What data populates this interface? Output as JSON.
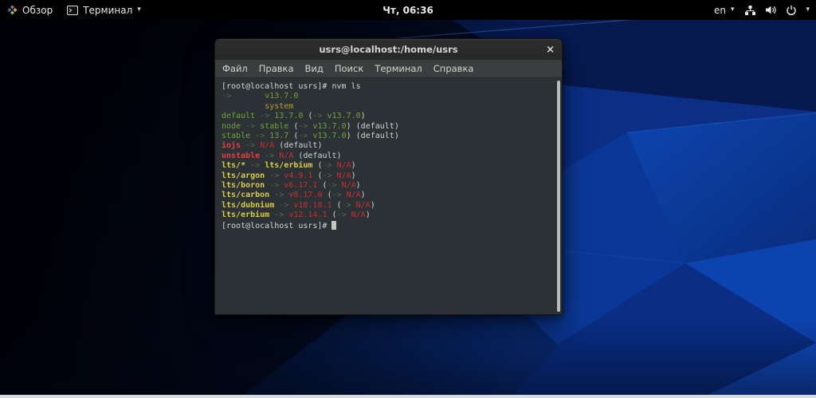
{
  "palette": {
    "topbar_bg": "#000000",
    "titlebar_bg": "#2e2e2e",
    "menubar_bg": "#3a3e3f",
    "term_bg": "#2b3134",
    "term_fg": "#d3d7cf",
    "green": "#6fa436",
    "dim_arrow": "#5b6a48",
    "yellow": "#b1a02a",
    "yellow_bright": "#d8cb46",
    "red": "#ce2d2d",
    "red_bright": "#eb3d3d",
    "cursor": "#c2c8bd",
    "scrollbar": "#b6bbb9",
    "strip": "#d7dadd",
    "wall_bright": "#0c3da4"
  },
  "top_bar": {
    "activities_label": "Обзор",
    "app_menu_label": "Терминал",
    "clock": "Чт, 06:36",
    "language_label": "en",
    "caret": "▾"
  },
  "window": {
    "title": "usrs@localhost:/home/usrs",
    "close_glyph": "×",
    "menu_items": [
      "Файл",
      "Правка",
      "Вид",
      "Поиск",
      "Терминал",
      "Справка"
    ],
    "terminal": {
      "cursor_visible": true,
      "lines": [
        [
          {
            "t": "[root@localhost usrs]# nvm ls",
            "c": "fg"
          }
        ],
        [
          {
            "t": "->",
            "c": "dim"
          },
          {
            "t": "       ",
            "c": "fg"
          },
          {
            "t": "v13.7.0",
            "c": "green"
          }
        ],
        [
          {
            "t": "         system",
            "c": "yellow"
          }
        ],
        [
          {
            "t": "default",
            "c": "green"
          },
          {
            "t": " ",
            "c": "fg"
          },
          {
            "t": "->",
            "c": "dim"
          },
          {
            "t": " ",
            "c": "fg"
          },
          {
            "t": "13.7.0",
            "c": "green"
          },
          {
            "t": " (",
            "c": "fg"
          },
          {
            "t": "->",
            "c": "dim"
          },
          {
            "t": " ",
            "c": "fg"
          },
          {
            "t": "v13.7.0",
            "c": "green"
          },
          {
            "t": ")",
            "c": "fg"
          }
        ],
        [
          {
            "t": "node",
            "c": "green"
          },
          {
            "t": " ",
            "c": "fg"
          },
          {
            "t": "->",
            "c": "dim"
          },
          {
            "t": " ",
            "c": "fg"
          },
          {
            "t": "stable",
            "c": "green"
          },
          {
            "t": " (",
            "c": "fg"
          },
          {
            "t": "->",
            "c": "dim"
          },
          {
            "t": " ",
            "c": "fg"
          },
          {
            "t": "v13.7.0",
            "c": "green"
          },
          {
            "t": ") (default)",
            "c": "fg"
          }
        ],
        [
          {
            "t": "stable",
            "c": "green"
          },
          {
            "t": " ",
            "c": "fg"
          },
          {
            "t": "->",
            "c": "dim"
          },
          {
            "t": " ",
            "c": "fg"
          },
          {
            "t": "13.7",
            "c": "green"
          },
          {
            "t": " (",
            "c": "fg"
          },
          {
            "t": "->",
            "c": "dim"
          },
          {
            "t": " ",
            "c": "fg"
          },
          {
            "t": "v13.7.0",
            "c": "green"
          },
          {
            "t": ") (default)",
            "c": "fg"
          }
        ],
        [
          {
            "t": "iojs",
            "c": "bred",
            "b": 1
          },
          {
            "t": " ",
            "c": "fg"
          },
          {
            "t": "->",
            "c": "dim"
          },
          {
            "t": " ",
            "c": "fg"
          },
          {
            "t": "N/A",
            "c": "red"
          },
          {
            "t": " (default)",
            "c": "fg"
          }
        ],
        [
          {
            "t": "unstable",
            "c": "bred",
            "b": 1
          },
          {
            "t": " ",
            "c": "fg"
          },
          {
            "t": "->",
            "c": "dim"
          },
          {
            "t": " ",
            "c": "fg"
          },
          {
            "t": "N/A",
            "c": "red"
          },
          {
            "t": " (default)",
            "c": "fg"
          }
        ],
        [
          {
            "t": "lts/*",
            "c": "byellow",
            "b": 1
          },
          {
            "t": " ",
            "c": "fg"
          },
          {
            "t": "->",
            "c": "dim"
          },
          {
            "t": " ",
            "c": "fg"
          },
          {
            "t": "lts/erbium",
            "c": "byellow",
            "b": 1
          },
          {
            "t": " (",
            "c": "fg"
          },
          {
            "t": "->",
            "c": "dim"
          },
          {
            "t": " ",
            "c": "fg"
          },
          {
            "t": "N/A",
            "c": "red"
          },
          {
            "t": ")",
            "c": "fg"
          }
        ],
        [
          {
            "t": "lts/argon",
            "c": "byellow",
            "b": 1
          },
          {
            "t": " ",
            "c": "fg"
          },
          {
            "t": "->",
            "c": "dim"
          },
          {
            "t": " ",
            "c": "fg"
          },
          {
            "t": "v4.9.1",
            "c": "red"
          },
          {
            "t": " (",
            "c": "fg"
          },
          {
            "t": "->",
            "c": "dim"
          },
          {
            "t": " ",
            "c": "fg"
          },
          {
            "t": "N/A",
            "c": "red"
          },
          {
            "t": ")",
            "c": "fg"
          }
        ],
        [
          {
            "t": "lts/boron",
            "c": "byellow",
            "b": 1
          },
          {
            "t": " ",
            "c": "fg"
          },
          {
            "t": "->",
            "c": "dim"
          },
          {
            "t": " ",
            "c": "fg"
          },
          {
            "t": "v6.17.1",
            "c": "red"
          },
          {
            "t": " (",
            "c": "fg"
          },
          {
            "t": "->",
            "c": "dim"
          },
          {
            "t": " ",
            "c": "fg"
          },
          {
            "t": "N/A",
            "c": "red"
          },
          {
            "t": ")",
            "c": "fg"
          }
        ],
        [
          {
            "t": "lts/carbon",
            "c": "byellow",
            "b": 1
          },
          {
            "t": " ",
            "c": "fg"
          },
          {
            "t": "->",
            "c": "dim"
          },
          {
            "t": " ",
            "c": "fg"
          },
          {
            "t": "v8.17.0",
            "c": "red"
          },
          {
            "t": " (",
            "c": "fg"
          },
          {
            "t": "->",
            "c": "dim"
          },
          {
            "t": " ",
            "c": "fg"
          },
          {
            "t": "N/A",
            "c": "red"
          },
          {
            "t": ")",
            "c": "fg"
          }
        ],
        [
          {
            "t": "lts/dubnium",
            "c": "byellow",
            "b": 1
          },
          {
            "t": " ",
            "c": "fg"
          },
          {
            "t": "->",
            "c": "dim"
          },
          {
            "t": " ",
            "c": "fg"
          },
          {
            "t": "v10.18.1",
            "c": "red"
          },
          {
            "t": " (",
            "c": "fg"
          },
          {
            "t": "->",
            "c": "dim"
          },
          {
            "t": " ",
            "c": "fg"
          },
          {
            "t": "N/A",
            "c": "red"
          },
          {
            "t": ")",
            "c": "fg"
          }
        ],
        [
          {
            "t": "lts/erbium",
            "c": "byellow",
            "b": 1
          },
          {
            "t": " ",
            "c": "fg"
          },
          {
            "t": "->",
            "c": "dim"
          },
          {
            "t": " ",
            "c": "fg"
          },
          {
            "t": "v12.14.1",
            "c": "red"
          },
          {
            "t": " (",
            "c": "fg"
          },
          {
            "t": "->",
            "c": "dim"
          },
          {
            "t": " ",
            "c": "fg"
          },
          {
            "t": "N/A",
            "c": "red"
          },
          {
            "t": ")",
            "c": "fg"
          }
        ],
        [
          {
            "t": "[root@localhost usrs]# ",
            "c": "fg"
          }
        ]
      ]
    }
  }
}
